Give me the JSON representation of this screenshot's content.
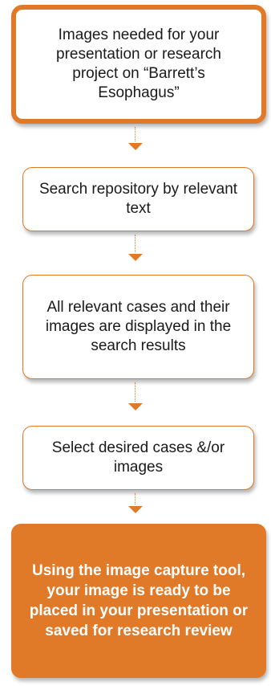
{
  "flowchart": {
    "start": {
      "text": "Images needed for your presentation or research project on “Barrett’s Esophagus”"
    },
    "steps": [
      {
        "text": "Search repository by relevant text"
      },
      {
        "text": "All relevant cases and their images are displayed in the search results"
      },
      {
        "text": "Select desired cases &/or images"
      }
    ],
    "end": {
      "text": "Using the image capture tool, your image is ready to be placed in your presentation or saved for research review"
    }
  },
  "colors": {
    "accent": "#E07A28",
    "text": "#1a1a1a",
    "background": "#ffffff"
  }
}
